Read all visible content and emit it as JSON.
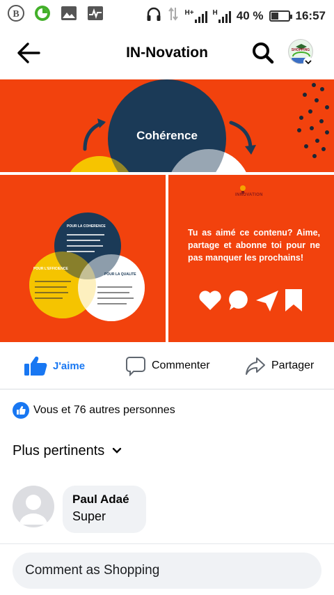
{
  "status_bar": {
    "left_icons": [
      "b-circle-icon",
      "green-ring-icon",
      "gallery-icon",
      "pulse-icon"
    ],
    "network_1": "H+",
    "network_2": "H",
    "battery_percent": "40 %",
    "time": "16:57"
  },
  "header": {
    "title": "IN-Novation",
    "page_avatar_label": "SHOPPING"
  },
  "post_images": {
    "top": {
      "title": "Cohérence"
    },
    "bottom_left": {
      "title": "POUR LA COHERENCE",
      "circle_left_title": "POUR L'EFFICIENCE",
      "circle_right_title": "POUR LA QUALITE"
    },
    "bottom_right": {
      "brand": "INNOVATION",
      "cta": "Tu as aimé ce contenu? Aime, partage et abonne toi pour ne pas manquer les prochains!"
    }
  },
  "actions": {
    "like": "J'aime",
    "comment": "Commenter",
    "share": "Partager"
  },
  "reactions": {
    "summary": "Vous et 76 autres personnes"
  },
  "sort": {
    "label": "Plus pertinents"
  },
  "comments": [
    {
      "author": "Paul Adaé",
      "text": "Super"
    }
  ],
  "composer": {
    "placeholder": "Comment as Shopping"
  },
  "colors": {
    "brand_orange": "#f2420d",
    "navy": "#1b3a57",
    "yellow": "#f5c400",
    "facebook_blue": "#1877f2"
  }
}
